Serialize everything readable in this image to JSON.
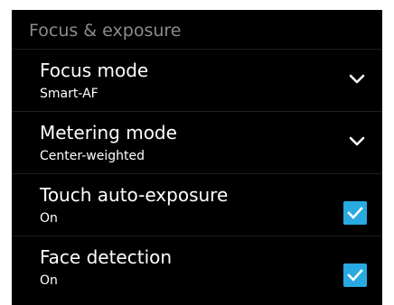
{
  "section": {
    "title": "Focus & exposure"
  },
  "settings": [
    {
      "title": "Focus mode",
      "value": "Smart-AF",
      "control": "dropdown"
    },
    {
      "title": "Metering mode",
      "value": "Center-weighted",
      "control": "dropdown"
    },
    {
      "title": "Touch auto-exposure",
      "value": "On",
      "control": "checkbox",
      "checked": true
    },
    {
      "title": "Face detection",
      "value": "On",
      "control": "checkbox",
      "checked": true
    }
  ],
  "colors": {
    "background": "#000000",
    "header_text": "#8b8b8b",
    "checkbox_accent": "#29a9e1",
    "divider": "#1e1e1e"
  },
  "icons": {
    "dropdown": "chevron-down-icon",
    "checkbox": "checkmark-icon"
  }
}
